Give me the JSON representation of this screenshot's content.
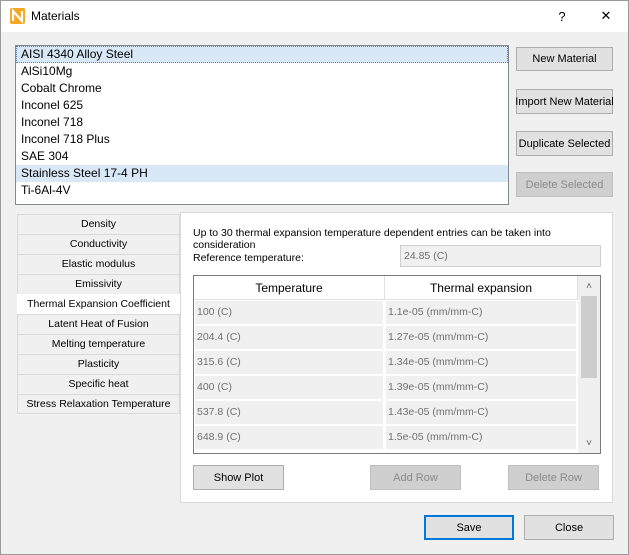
{
  "window": {
    "title": "Materials",
    "help": "?",
    "close": "✕"
  },
  "materials": [
    "AISI 4340 Alloy Steel",
    "AlSi10Mg",
    "Cobalt Chrome",
    "Inconel 625",
    "Inconel 718",
    "Inconel 718 Plus",
    "SAE 304",
    "Stainless Steel 17-4 PH",
    "Ti-6Al-4V"
  ],
  "material_buttons": {
    "new": "New Material",
    "import": "Import New Material",
    "duplicate": "Duplicate Selected",
    "delete": "Delete Selected"
  },
  "properties": [
    "Density",
    "Conductivity",
    "Elastic modulus",
    "Emissivity",
    "Thermal Expansion Coefficient",
    "Latent Heat of Fusion",
    "Melting temperature",
    "Plasticity",
    "Specific heat",
    "Stress Relaxation Temperature"
  ],
  "panel": {
    "info": "Up to 30 thermal expansion temperature dependent entries can be taken into consideration",
    "ref_label": "Reference temperature:",
    "ref_value": "24.85 (C)",
    "columns": [
      "Temperature",
      "Thermal expansion"
    ],
    "rows": [
      [
        "100 (C)",
        "1.1e-05 (mm/mm-C)"
      ],
      [
        "204.4 (C)",
        "1.27e-05 (mm/mm-C)"
      ],
      [
        "315.6 (C)",
        "1.34e-05 (mm/mm-C)"
      ],
      [
        "400 (C)",
        "1.39e-05 (mm/mm-C)"
      ],
      [
        "537.8 (C)",
        "1.43e-05 (mm/mm-C)"
      ],
      [
        "648.9 (C)",
        "1.5e-05 (mm/mm-C)"
      ]
    ],
    "show_plot": "Show Plot",
    "add_row": "Add Row",
    "delete_row": "Delete Row"
  },
  "footer": {
    "save": "Save",
    "close": "Close"
  }
}
